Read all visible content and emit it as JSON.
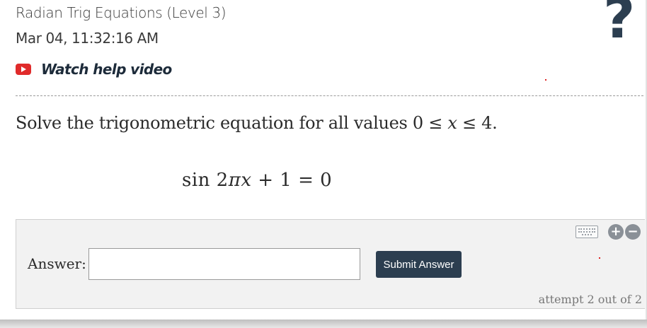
{
  "header": {
    "title": "Radian Trig Equations (Level 3)",
    "datetime": "Mar 04, 11:32:16 AM",
    "help_video_label": "Watch help video",
    "help_icon_glyph": "?"
  },
  "question": {
    "prompt_text": "Solve the trigonometric equation for all values ",
    "bound_low": "0",
    "leq_1": "≤",
    "variable": "x",
    "leq_2": "≤",
    "bound_high": "4",
    "end_period": ".",
    "equation_fn": "sin",
    "equation_coef": "2",
    "equation_pi": "π",
    "equation_var": "x",
    "equation_rest": " + 1 = 0"
  },
  "answer_panel": {
    "label": "Answer:",
    "input_value": "",
    "input_placeholder": "",
    "submit_label": "Submit Answer",
    "zoom_in_glyph": "+",
    "zoom_out_glyph": "−",
    "attempt_text": "attempt 2 out of 2"
  },
  "colors": {
    "brand_dark": "#2c3e50",
    "video_red": "#e02b2b",
    "panel_bg": "#f2f2f2"
  },
  "icons": {
    "video": "youtube-play-icon",
    "help": "question-mark-icon",
    "keyboard": "keyboard-icon",
    "zoom_in": "plus-circle-icon",
    "zoom_out": "minus-circle-icon"
  }
}
